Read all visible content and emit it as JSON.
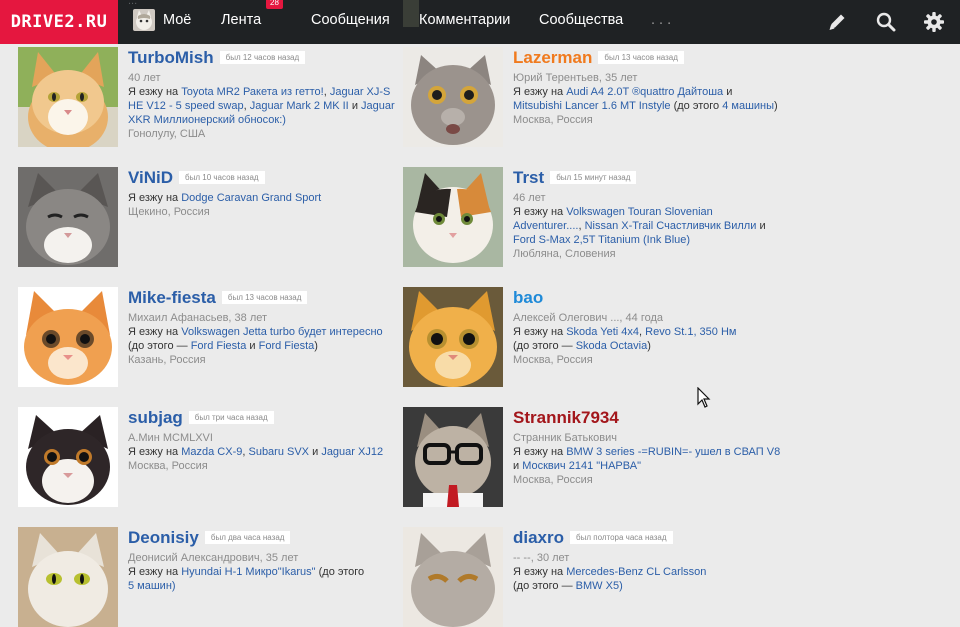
{
  "nav": {
    "logo": "DRIVE2.RU",
    "moe": "Моё",
    "lenta": "Лента",
    "lenta_badge": "28",
    "messages": "Сообщения",
    "comments": "Комментарии",
    "communities": "Сообщества",
    "more": ". . ."
  },
  "ghost_text": "...",
  "users": [
    {
      "name": "TurboMish",
      "name_color": "blue",
      "seen": "был 12 часов назад",
      "meta": "40 лет",
      "drive_prefix": "Я езжу на",
      "cars": [
        "Toyota MR2 Ракета из гетто!",
        "Jaguar XJ-S HE V12 - 5 speed swap",
        "Jaguar Mark 2 MK II",
        "Jaguar XKR Миллионерский обносок:)"
      ],
      "location": "Гонолулу, США"
    },
    {
      "name": "Lazerman",
      "name_color": "orange",
      "seen": "был 13 часов назад",
      "meta": "Юрий Терентьев, 35 лет",
      "drive_prefix": "Я езжу на",
      "cars": [
        "Audi A4 2.0T ®quattro Дайтоша",
        "Mitsubishi Lancer 1.6 MT Instyle"
      ],
      "before_prefix": "до этого",
      "before_cars": [
        "4 машины"
      ],
      "location": "Москва, Россия"
    },
    {
      "name": "ViNiD",
      "name_color": "blue",
      "seen": "был 10 часов назад",
      "meta": "",
      "drive_prefix": "Я езжу на",
      "cars": [
        "Dodge Caravan Grand Sport"
      ],
      "location": "Щекино, Россия"
    },
    {
      "name": "Trst",
      "name_color": "blue",
      "seen": "был 15 минут назад",
      "meta": "46 лет",
      "drive_prefix": "Я езжу на",
      "cars": [
        "Volkswagen Touran Slovenian Adventurer....",
        "Nissan X-Trail Счастливчик Вилли",
        "Ford S-Max 2,5T Titanium (Ink Blue)"
      ],
      "location": "Любляна, Словения"
    },
    {
      "name": "Mike-fiesta",
      "name_color": "blue",
      "seen": "был 13 часов назад",
      "meta": "Михаил Афанасьев, 38 лет",
      "drive_prefix": "Я езжу на",
      "cars": [
        "Volkswagen Jetta turbo будет интересно"
      ],
      "before_prefix": "до этого —",
      "before_cars": [
        "Ford Fiesta",
        "Ford Fiesta"
      ],
      "location": "Казань, Россия"
    },
    {
      "name": "bao",
      "name_color": "lightblue",
      "seen": "",
      "meta": "Алексей Олегович ..., 44 года",
      "drive_prefix": "Я езжу на",
      "cars": [
        "Skoda Yeti 4x4",
        "Revo St.1, 350 Нм"
      ],
      "before_prefix": "до этого —",
      "before_cars": [
        "Skoda Octavia"
      ],
      "location": "Москва, Россия"
    },
    {
      "name": "subjag",
      "name_color": "blue",
      "seen": "был три часа назад",
      "meta": "А.Мин MCMLXVI",
      "drive_prefix": "Я езжу на",
      "cars": [
        "Mazda CX-9",
        "Subaru SVX",
        "Jaguar XJ12"
      ],
      "location": "Москва, Россия"
    },
    {
      "name": "Strannik7934",
      "name_color": "red",
      "seen": "",
      "meta": "Странник Батькович",
      "drive_prefix": "Я езжу на",
      "cars": [
        "BMW 3 series -=RUBIN=- ушел в СВАП V8",
        "Москвич 2141 \"НАРВА\""
      ],
      "location": "Москва, Россия"
    },
    {
      "name": "Deonisiy",
      "name_color": "blue",
      "seen": "был два часа назад",
      "meta": "Деонисий Александрович, 35 лет",
      "drive_prefix": "Я езжу на",
      "cars": [
        "Hyundai H-1 Микро\"Ikarus\""
      ],
      "before_prefix": "(до этого",
      "before_cars": [
        "5 машин)"
      ],
      "location": ""
    },
    {
      "name": "diaxro",
      "name_color": "blue",
      "seen": "был полтора часа назад",
      "meta": "-- --, 30 лет",
      "drive_prefix": "Я езжу на",
      "cars": [
        "Mercedes-Benz CL Carlsson"
      ],
      "before_prefix": "(до этого —",
      "before_cars": [
        "BMW X5)"
      ],
      "location": ""
    }
  ],
  "words": {
    "and": "и",
    "comma": ",",
    "open_before": "(до этого",
    "close": ")"
  },
  "colors": {
    "brand": "#e5173f",
    "topbar": "#1f2224",
    "link": "#2b5ea8",
    "background": "#ebebeb"
  },
  "icons": [
    "pencil-icon",
    "search-icon",
    "gear-icon"
  ]
}
